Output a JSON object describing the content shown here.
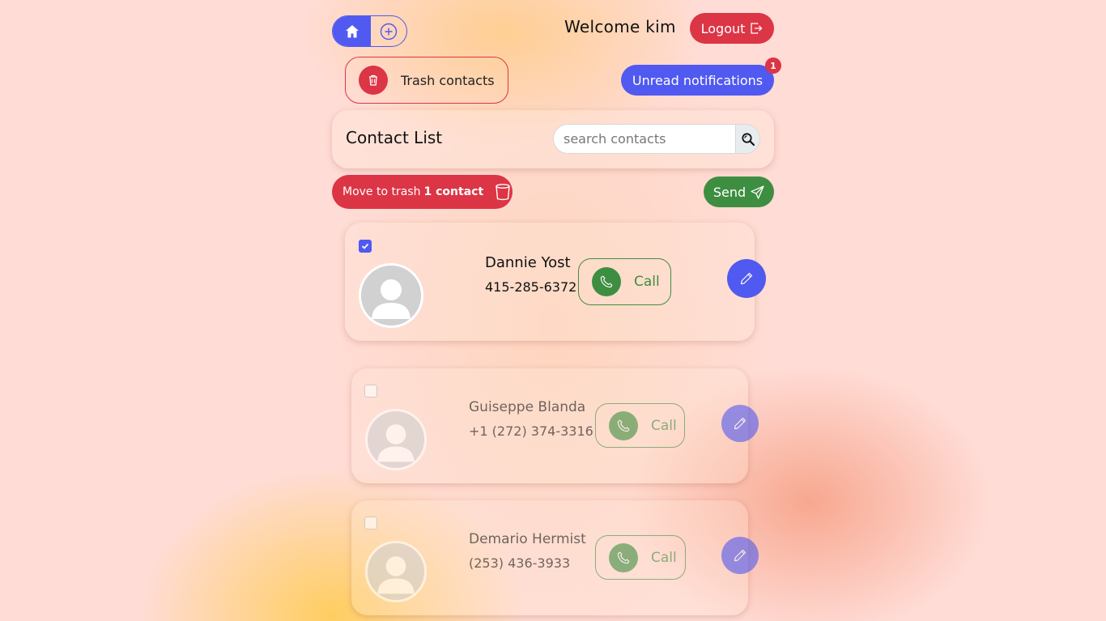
{
  "nav": {
    "home_icon": "house-icon",
    "add_icon": "plus-circle-icon",
    "welcome_text": "Welcome kim",
    "logout_label": "Logout",
    "logout_icon": "box-arrow-right-icon"
  },
  "trash_link": {
    "label": "Trash contacts",
    "icon": "trash-icon"
  },
  "notifications": {
    "label": "Unread notifications",
    "count": "1"
  },
  "contact_list": {
    "title": "Contact List",
    "search": {
      "placeholder": "search contacts",
      "value": "",
      "icon": "search-icon"
    }
  },
  "actions": {
    "move_to_trash_prefix": "Move to trash",
    "move_to_trash_count": "1 contact",
    "send_label": "Send",
    "send_icon": "send-icon"
  },
  "contacts": [
    {
      "name": "Dannie Yost",
      "phone": "415-285-6372",
      "call_label": "Call",
      "checked": true
    },
    {
      "name": "Guiseppe Blanda",
      "phone": "+1 (272) 374-3316",
      "call_label": "Call",
      "checked": false
    },
    {
      "name": "Demario Hermist",
      "phone": "(253) 436-3933",
      "call_label": "Call",
      "checked": false
    }
  ],
  "colors": {
    "primary": "#5059f0",
    "danger": "#dc3545",
    "success": "#3e8e41",
    "background": "#ffdcd6"
  }
}
